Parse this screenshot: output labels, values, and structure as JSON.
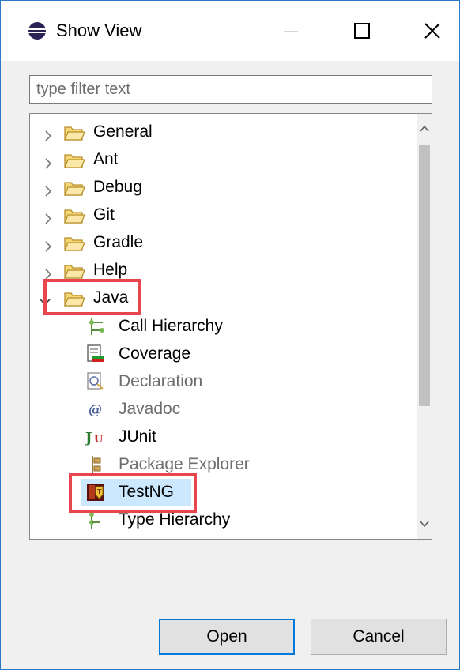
{
  "window": {
    "title": "Show View",
    "controls": [
      "minimize-icon",
      "maximize-icon",
      "close-icon"
    ]
  },
  "filter": {
    "value": "",
    "placeholder": "type filter text"
  },
  "tree": {
    "categories": [
      {
        "label": "General",
        "expanded": false
      },
      {
        "label": "Ant",
        "expanded": false
      },
      {
        "label": "Debug",
        "expanded": false
      },
      {
        "label": "Git",
        "expanded": false
      },
      {
        "label": "Gradle",
        "expanded": false
      },
      {
        "label": "Help",
        "expanded": false
      },
      {
        "label": "Java",
        "expanded": true
      }
    ],
    "java_views": [
      {
        "label": "Call Hierarchy",
        "icon": "call-hierarchy-icon",
        "enabled": true
      },
      {
        "label": "Coverage",
        "icon": "coverage-icon",
        "enabled": true
      },
      {
        "label": "Declaration",
        "icon": "declaration-icon",
        "enabled": false
      },
      {
        "label": "Javadoc",
        "icon": "javadoc-icon",
        "enabled": false
      },
      {
        "label": "JUnit",
        "icon": "junit-icon",
        "enabled": true
      },
      {
        "label": "Package Explorer",
        "icon": "package-explorer-icon",
        "enabled": false
      },
      {
        "label": "TestNG",
        "icon": "testng-icon",
        "enabled": true,
        "selected": true
      },
      {
        "label": "Type Hierarchy",
        "icon": "type-hierarchy-icon",
        "enabled": true
      }
    ],
    "highlight_color": "#e8454f",
    "selection_color": "#cce8ff"
  },
  "buttons": {
    "open_label": "Open",
    "cancel_label": "Cancel"
  },
  "colors": {
    "accent": "#0078d7",
    "window_border": "#2b78c8"
  }
}
